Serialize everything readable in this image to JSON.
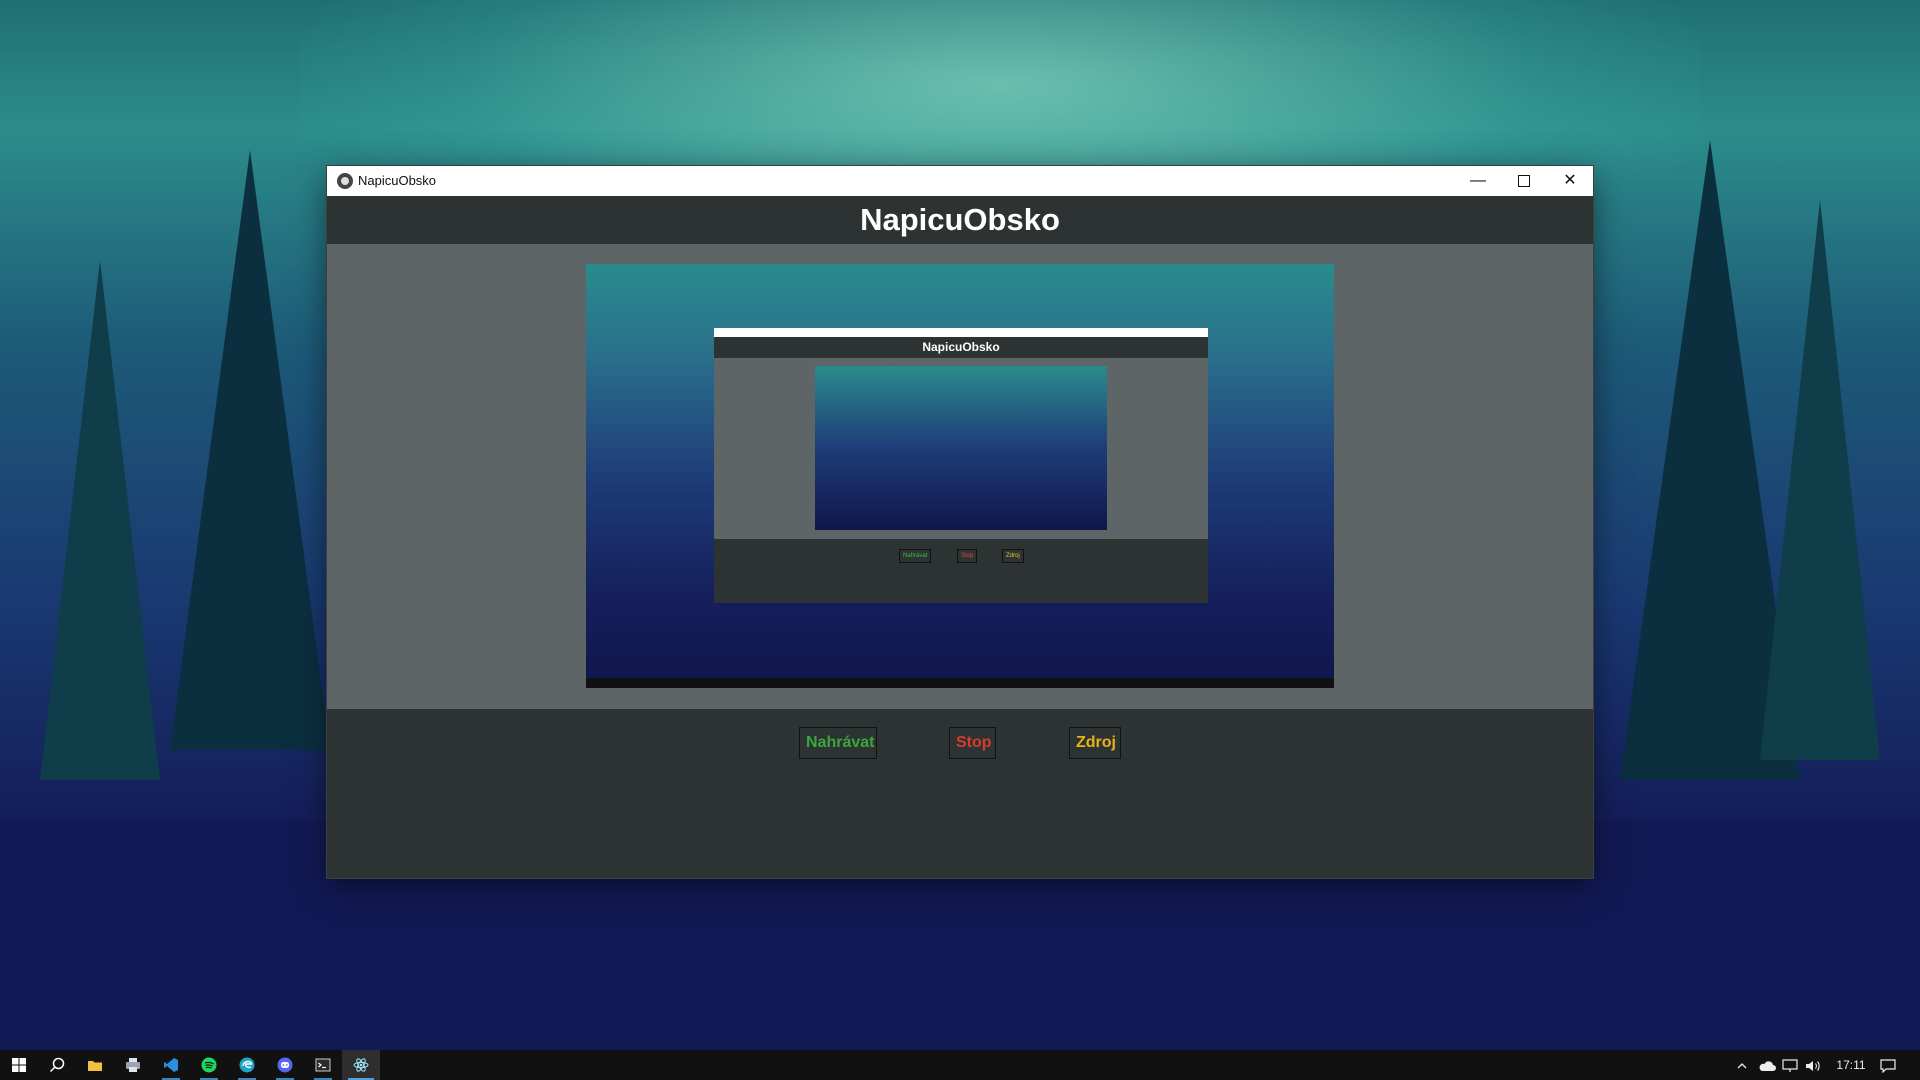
{
  "window": {
    "title": "NapicuObsko",
    "controls": {
      "minimize": "—",
      "maximize": "",
      "close": "✕"
    }
  },
  "app": {
    "heading": "NapicuObsko",
    "preview": {
      "nested_heading": "NapicuObsko",
      "nested_buttons": {
        "record": "Nahrávat",
        "stop": "Stop",
        "source": "Zdroj"
      }
    },
    "buttons": {
      "record": "Nahrávat",
      "stop": "Stop",
      "source": "Zdroj"
    }
  },
  "taskbar": {
    "apps": [
      "start-icon",
      "search-icon",
      "file-explorer-icon",
      "printer-icon",
      "vscode-icon",
      "spotify-icon",
      "edge-icon",
      "discord-icon",
      "terminal-icon",
      "electron-app-icon"
    ],
    "clock": "17:11"
  },
  "colors": {
    "record": "#3aa83a",
    "stop": "#d63c2a",
    "source": "#e6b418",
    "app_bg": "#2d3233",
    "preview_bg": "#5d6566"
  }
}
